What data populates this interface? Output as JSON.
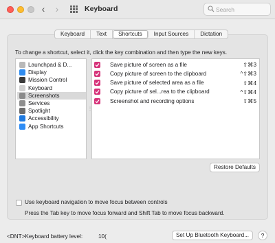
{
  "window": {
    "title": "Keyboard"
  },
  "search": {
    "placeholder": "Search"
  },
  "tabs": [
    {
      "label": "Keyboard",
      "active": false
    },
    {
      "label": "Text",
      "active": false
    },
    {
      "label": "Shortcuts",
      "active": true
    },
    {
      "label": "Input Sources",
      "active": false
    },
    {
      "label": "Dictation",
      "active": false
    }
  ],
  "instructions": "To change a shortcut, select it, click the key combination and then type the new keys.",
  "categories": [
    {
      "label": "Launchpad & D...",
      "icon": "launchpad-icon",
      "color": "#b9b9b9",
      "selected": false
    },
    {
      "label": "Display",
      "icon": "display-icon",
      "color": "#2f8cf0",
      "selected": false
    },
    {
      "label": "Mission Control",
      "icon": "mission-control-icon",
      "color": "#3a3a3a",
      "selected": false
    },
    {
      "label": "Keyboard",
      "icon": "keyboard-icon",
      "color": "#d0d0d0",
      "selected": false
    },
    {
      "label": "Screenshots",
      "icon": "screenshot-icon",
      "color": "#8a8a8a",
      "selected": true
    },
    {
      "label": "Services",
      "icon": "gear-icon",
      "color": "#8e8e8e",
      "selected": false
    },
    {
      "label": "Spotlight",
      "icon": "magnifier-icon",
      "color": "#6d6d6d",
      "selected": false
    },
    {
      "label": "Accessibility",
      "icon": "accessibility-icon",
      "color": "#1f7ae0",
      "selected": false
    },
    {
      "label": "App Shortcuts",
      "icon": "app-store-icon",
      "color": "#2d8cf5",
      "selected": false
    }
  ],
  "shortcuts": [
    {
      "label": "Save picture of screen as a file",
      "keys": "⇧⌘3",
      "enabled": true
    },
    {
      "label": "Copy picture of screen to the clipboard",
      "keys": "^⇧⌘3",
      "enabled": true
    },
    {
      "label": "Save picture of selected area as a file",
      "keys": "⇧⌘4",
      "enabled": true
    },
    {
      "label": "Copy picture of sel...rea to the clipboard",
      "keys": "^⇧⌘4",
      "enabled": true
    },
    {
      "label": "Screenshot and recording options",
      "keys": "⇧⌘5",
      "enabled": true
    }
  ],
  "restore_label": "Restore Defaults",
  "keyboard_navigation": {
    "label": "Use keyboard navigation to move focus between controls",
    "checked": false,
    "help": "Press the Tab key to move focus forward and Shift Tab to move focus backward."
  },
  "battery": {
    "label": "<DNT>Keyboard battery level:",
    "value": "10("
  },
  "bluetooth_label": "Set Up Bluetooth Keyboard...",
  "help_label": "?",
  "colors": {
    "checkbox": "#d6337a",
    "close": "#ff5f57",
    "minimize": "#febc2e"
  }
}
